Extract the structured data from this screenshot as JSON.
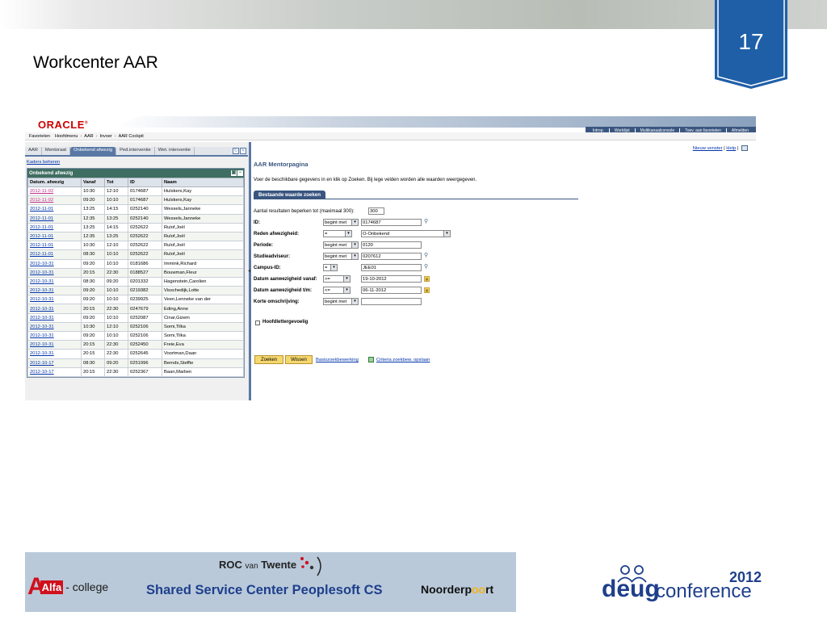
{
  "slide": {
    "page_number": "17",
    "title": "Workcenter AAR"
  },
  "app": {
    "logo": "ORACLE",
    "top_links": [
      "Introp.",
      "Worklijst",
      "Multikanaalconsole",
      "Toev. aan favorieten",
      "Afmelden"
    ],
    "breadcrumbs": [
      "Favorieten",
      "Hoofdmenu",
      "AAR",
      "Invoer",
      "AAR Cockpit"
    ],
    "left": {
      "tabs": [
        "AAR",
        "Mentoraat",
        "Onbekend afwezig",
        "Ped.interventie",
        "Wet. interventie"
      ],
      "active_tab": "Onbekend afwezig",
      "kaders_link": "Kaders beheren",
      "grid_title": "Onbekend afwezig",
      "columns": [
        "Datum. afwezig",
        "Vanaf",
        "Tot",
        "ID",
        "Naam"
      ],
      "rows": [
        [
          "2012-11-02",
          "10:30",
          "12:10",
          "0174687",
          "Hulskers,Kay"
        ],
        [
          "2012-11-02",
          "09:20",
          "10:10",
          "0174687",
          "Hulskers,Kay"
        ],
        [
          "2012-11-01",
          "13:25",
          "14:15",
          "0252140",
          "Wessels,Janneke"
        ],
        [
          "2012-11-01",
          "12:35",
          "13:25",
          "0252140",
          "Wessels,Janneke"
        ],
        [
          "2012-11-01",
          "13:25",
          "14:15",
          "0252622",
          "Rulof,Joël"
        ],
        [
          "2012-11-01",
          "12:35",
          "13:25",
          "0252622",
          "Rulof,Joël"
        ],
        [
          "2012-11-01",
          "10:30",
          "12:10",
          "0252622",
          "Rulof,Joël"
        ],
        [
          "2012-11-01",
          "08:30",
          "10:10",
          "0252622",
          "Rulof,Joël"
        ],
        [
          "2012-10-31",
          "09:20",
          "10:10",
          "0181686",
          "Immink,Richard"
        ],
        [
          "2012-10-31",
          "20:15",
          "22:30",
          "0188527",
          "Bouwman,Fleur"
        ],
        [
          "2012-10-31",
          "08:30",
          "09:20",
          "0201332",
          "Hagenstein,Carolien"
        ],
        [
          "2012-10-31",
          "09:20",
          "10:10",
          "0219382",
          "Visschedijk,Lotte"
        ],
        [
          "2012-10-31",
          "09:20",
          "10:10",
          "0239925",
          "Veen,Lenneke van der"
        ],
        [
          "2012-10-31",
          "20:15",
          "22:30",
          "0247679",
          "Eding,Anne"
        ],
        [
          "2012-10-31",
          "09:20",
          "10:10",
          "0252087",
          "Cinar,Gizem"
        ],
        [
          "2012-10-31",
          "10:30",
          "12:10",
          "0252106",
          "Somi,Tilka"
        ],
        [
          "2012-10-31",
          "09:20",
          "10:10",
          "0252106",
          "Somi,Tilka"
        ],
        [
          "2012-10-31",
          "20:15",
          "22:30",
          "0252450",
          "Freie,Eva"
        ],
        [
          "2012-10-31",
          "20:15",
          "22:30",
          "0252645",
          "Voortman,Daan"
        ],
        [
          "2012-10-17",
          "08:30",
          "09:20",
          "0251996",
          "Bernds,Steffie"
        ],
        [
          "2012-10-17",
          "20:15",
          "22:30",
          "0252367",
          "Baan,Marlien"
        ]
      ]
    },
    "right": {
      "nieuw_venster": "Nieuw venster",
      "help": "Help",
      "page_title": "AAR Mentorpagina",
      "instructions": "Voer de beschikbare gegevens in en klik op Zoeken. Bij lege velden worden alle waarden weergegeven.",
      "search_tab": "Bestaande waarde zoeken",
      "max_results_label": "Aantal resultaten beperken tot (maximaal 300):",
      "max_results_value": "300",
      "fields": [
        {
          "label": "ID:",
          "operator": "begint met",
          "value": "0174687"
        },
        {
          "label": "Reden afwezigheid:",
          "operator": "=",
          "value": "O-Onbekend"
        },
        {
          "label": "Periode:",
          "operator": "begint met",
          "value": "0120"
        },
        {
          "label": "Studieadviseur:",
          "operator": "begint met",
          "value": "0207612"
        },
        {
          "label": "Campus-ID:",
          "operator": "=",
          "value": "JEE01"
        },
        {
          "label": "Datum aanwezigheid vanaf:",
          "operator": ">=",
          "value": "19-10-2012"
        },
        {
          "label": "Datum aanwezigheid t/m:",
          "operator": "<=",
          "value": "06-11-2012"
        },
        {
          "label": "Korte omschrijving:",
          "operator": "begint met",
          "value": ""
        }
      ],
      "case_sensitive_label": "Hoofdlettergevoelig",
      "btn_zoeken": "Zoeken",
      "btn_wissen": "Wissen",
      "basis_link": "Basiszoekbewerking",
      "criteria_link": "Criteria zoekbew. opslaan"
    }
  },
  "footer": {
    "alfa_box": "Alfa",
    "alfa_college": "- college",
    "roc_1": "ROC",
    "roc_van": "van",
    "roc_2": "Twente",
    "ssc": "Shared Service Center Peoplesoft CS",
    "noorderpoort_1": "Noorderp",
    "noorderpoort_oo": "oo",
    "noorderpoort_2": "rt",
    "deug_year": "2012",
    "deug_word": "deug",
    "deug_conf": "conference"
  },
  "colors": {
    "badge_blue": "#1f5fa8",
    "ps_blue": "#3a5680",
    "grid_header_green": "#3e6e62",
    "button_yellow": "#f5d76e",
    "alfa_red": "#d10f1d",
    "ssc_blue": "#1e3f8c"
  }
}
